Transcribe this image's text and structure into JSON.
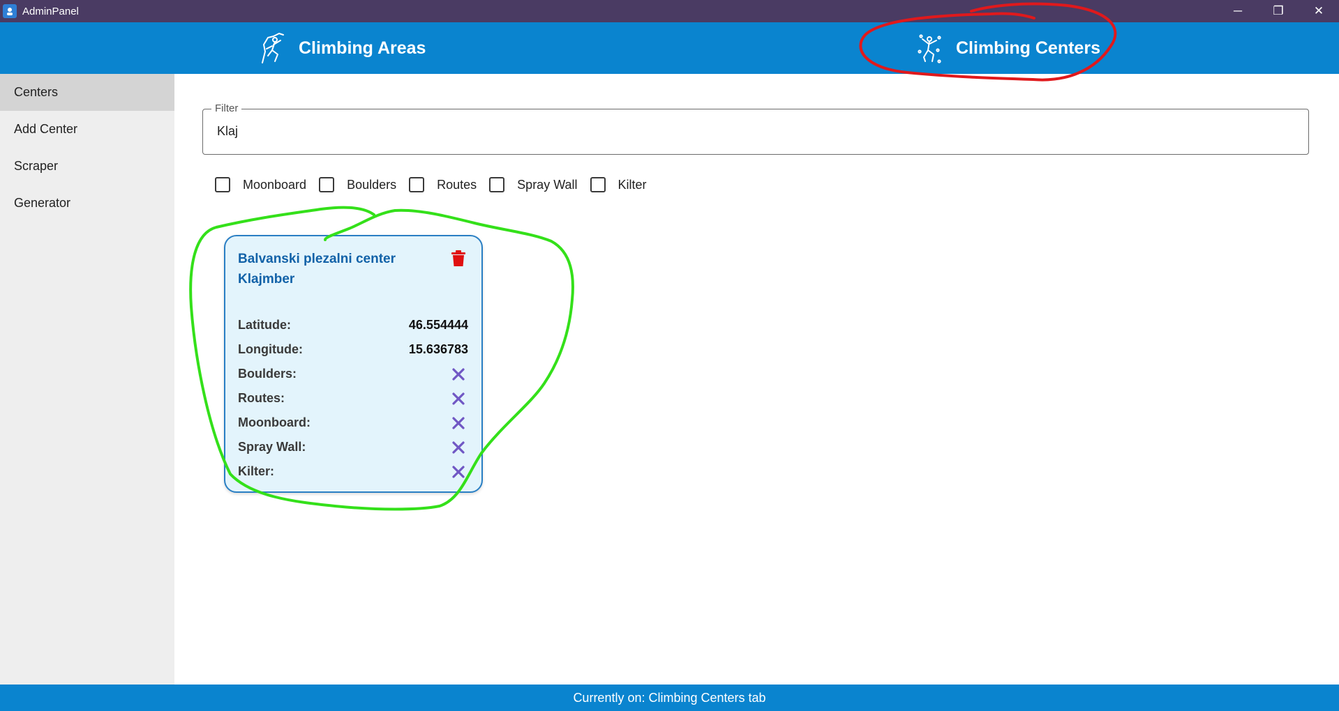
{
  "window": {
    "title": "AdminPanel",
    "controls": {
      "minimize": "─",
      "restore": "❐",
      "close": "✕"
    }
  },
  "topnav": {
    "tabs": [
      {
        "label": "Climbing Areas",
        "icon": "climber-icon"
      },
      {
        "label": "Climbing Centers",
        "icon": "indoor-climber-icon"
      }
    ],
    "active_tab": "Climbing Centers",
    "color": "#0a84cf"
  },
  "sidebar": {
    "items": [
      {
        "label": "Centers"
      },
      {
        "label": "Add Center"
      },
      {
        "label": "Scraper"
      },
      {
        "label": "Generator"
      }
    ],
    "active_item": "Centers"
  },
  "filter": {
    "legend": "Filter",
    "value": "Klaj"
  },
  "checkboxes": [
    {
      "label": "Moonboard",
      "checked": false
    },
    {
      "label": "Boulders",
      "checked": false
    },
    {
      "label": "Routes",
      "checked": false
    },
    {
      "label": "Spray Wall",
      "checked": false
    },
    {
      "label": "Kilter",
      "checked": false
    }
  ],
  "card": {
    "name": "Balvanski plezalni center Klajmber",
    "delete_icon": "trash-icon",
    "rows": [
      {
        "label": "Latitude:",
        "value": "46.554444"
      },
      {
        "label": "Longitude:",
        "value": "15.636783"
      },
      {
        "label": "Boulders:",
        "icon": "cross-icon"
      },
      {
        "label": "Routes:",
        "icon": "cross-icon"
      },
      {
        "label": "Moonboard:",
        "icon": "cross-icon"
      },
      {
        "label": "Spray Wall:",
        "icon": "cross-icon"
      },
      {
        "label": "Kilter:",
        "icon": "cross-icon"
      }
    ],
    "colors": {
      "background": "#e3f4fc",
      "border": "#2a7fc4",
      "title": "#1262a8",
      "trash": "#e01010",
      "cross": "#7057c4"
    }
  },
  "annotations": {
    "red_circle_color": "#e0191c",
    "green_circle_color": "#34e01a"
  },
  "statusbar": {
    "text": "Currently on: Climbing Centers tab"
  }
}
